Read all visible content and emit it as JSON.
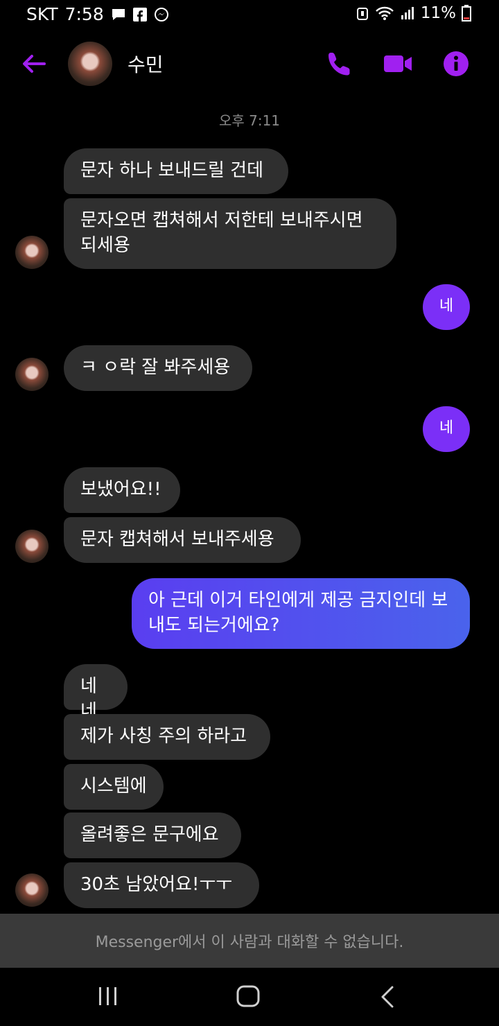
{
  "status_bar": {
    "carrier": "SKT",
    "time": "7:58",
    "battery": "11%"
  },
  "header": {
    "contact_name": "수민"
  },
  "timestamp": "오후 7:11",
  "messages": [
    {
      "side": "received",
      "text": "문자 하나 보내드릴 건데"
    },
    {
      "side": "received",
      "text": "문자오면 캡쳐해서 저한테 보내주시면 되세용"
    },
    {
      "side": "sent",
      "text": "네"
    },
    {
      "side": "received",
      "text": "ㅋ ㅇ락 잘 봐주세용"
    },
    {
      "side": "sent",
      "text": "네"
    },
    {
      "side": "received",
      "text": "보냈어요!!"
    },
    {
      "side": "received",
      "text": "문자 캡쳐해서 보내주세용"
    },
    {
      "side": "sent",
      "text": "아 근데 이거 타인에게 제공 금지인데 보내도 되는거에요?"
    },
    {
      "side": "received",
      "text": "네네"
    },
    {
      "side": "received",
      "text": "제가 사칭 주의 하라고"
    },
    {
      "side": "received",
      "text": "시스템에"
    },
    {
      "side": "received",
      "text": "올려좋은 문구에요"
    },
    {
      "side": "received",
      "text": "30초 남았어요!ㅜㅜ"
    }
  ],
  "footer_notice": "Messenger에서 이 사람과 대화할 수 없습니다.",
  "colors": {
    "accent": "#a020f0",
    "received_bubble": "#2f2f2f",
    "sent_bubble": "#7b2ff7"
  },
  "icons": {
    "back": "arrow-left-icon",
    "call": "phone-icon",
    "video": "video-camera-icon",
    "info": "info-icon",
    "nav_recents": "recents-icon",
    "nav_home": "home-icon",
    "nav_back": "chevron-left-icon"
  }
}
